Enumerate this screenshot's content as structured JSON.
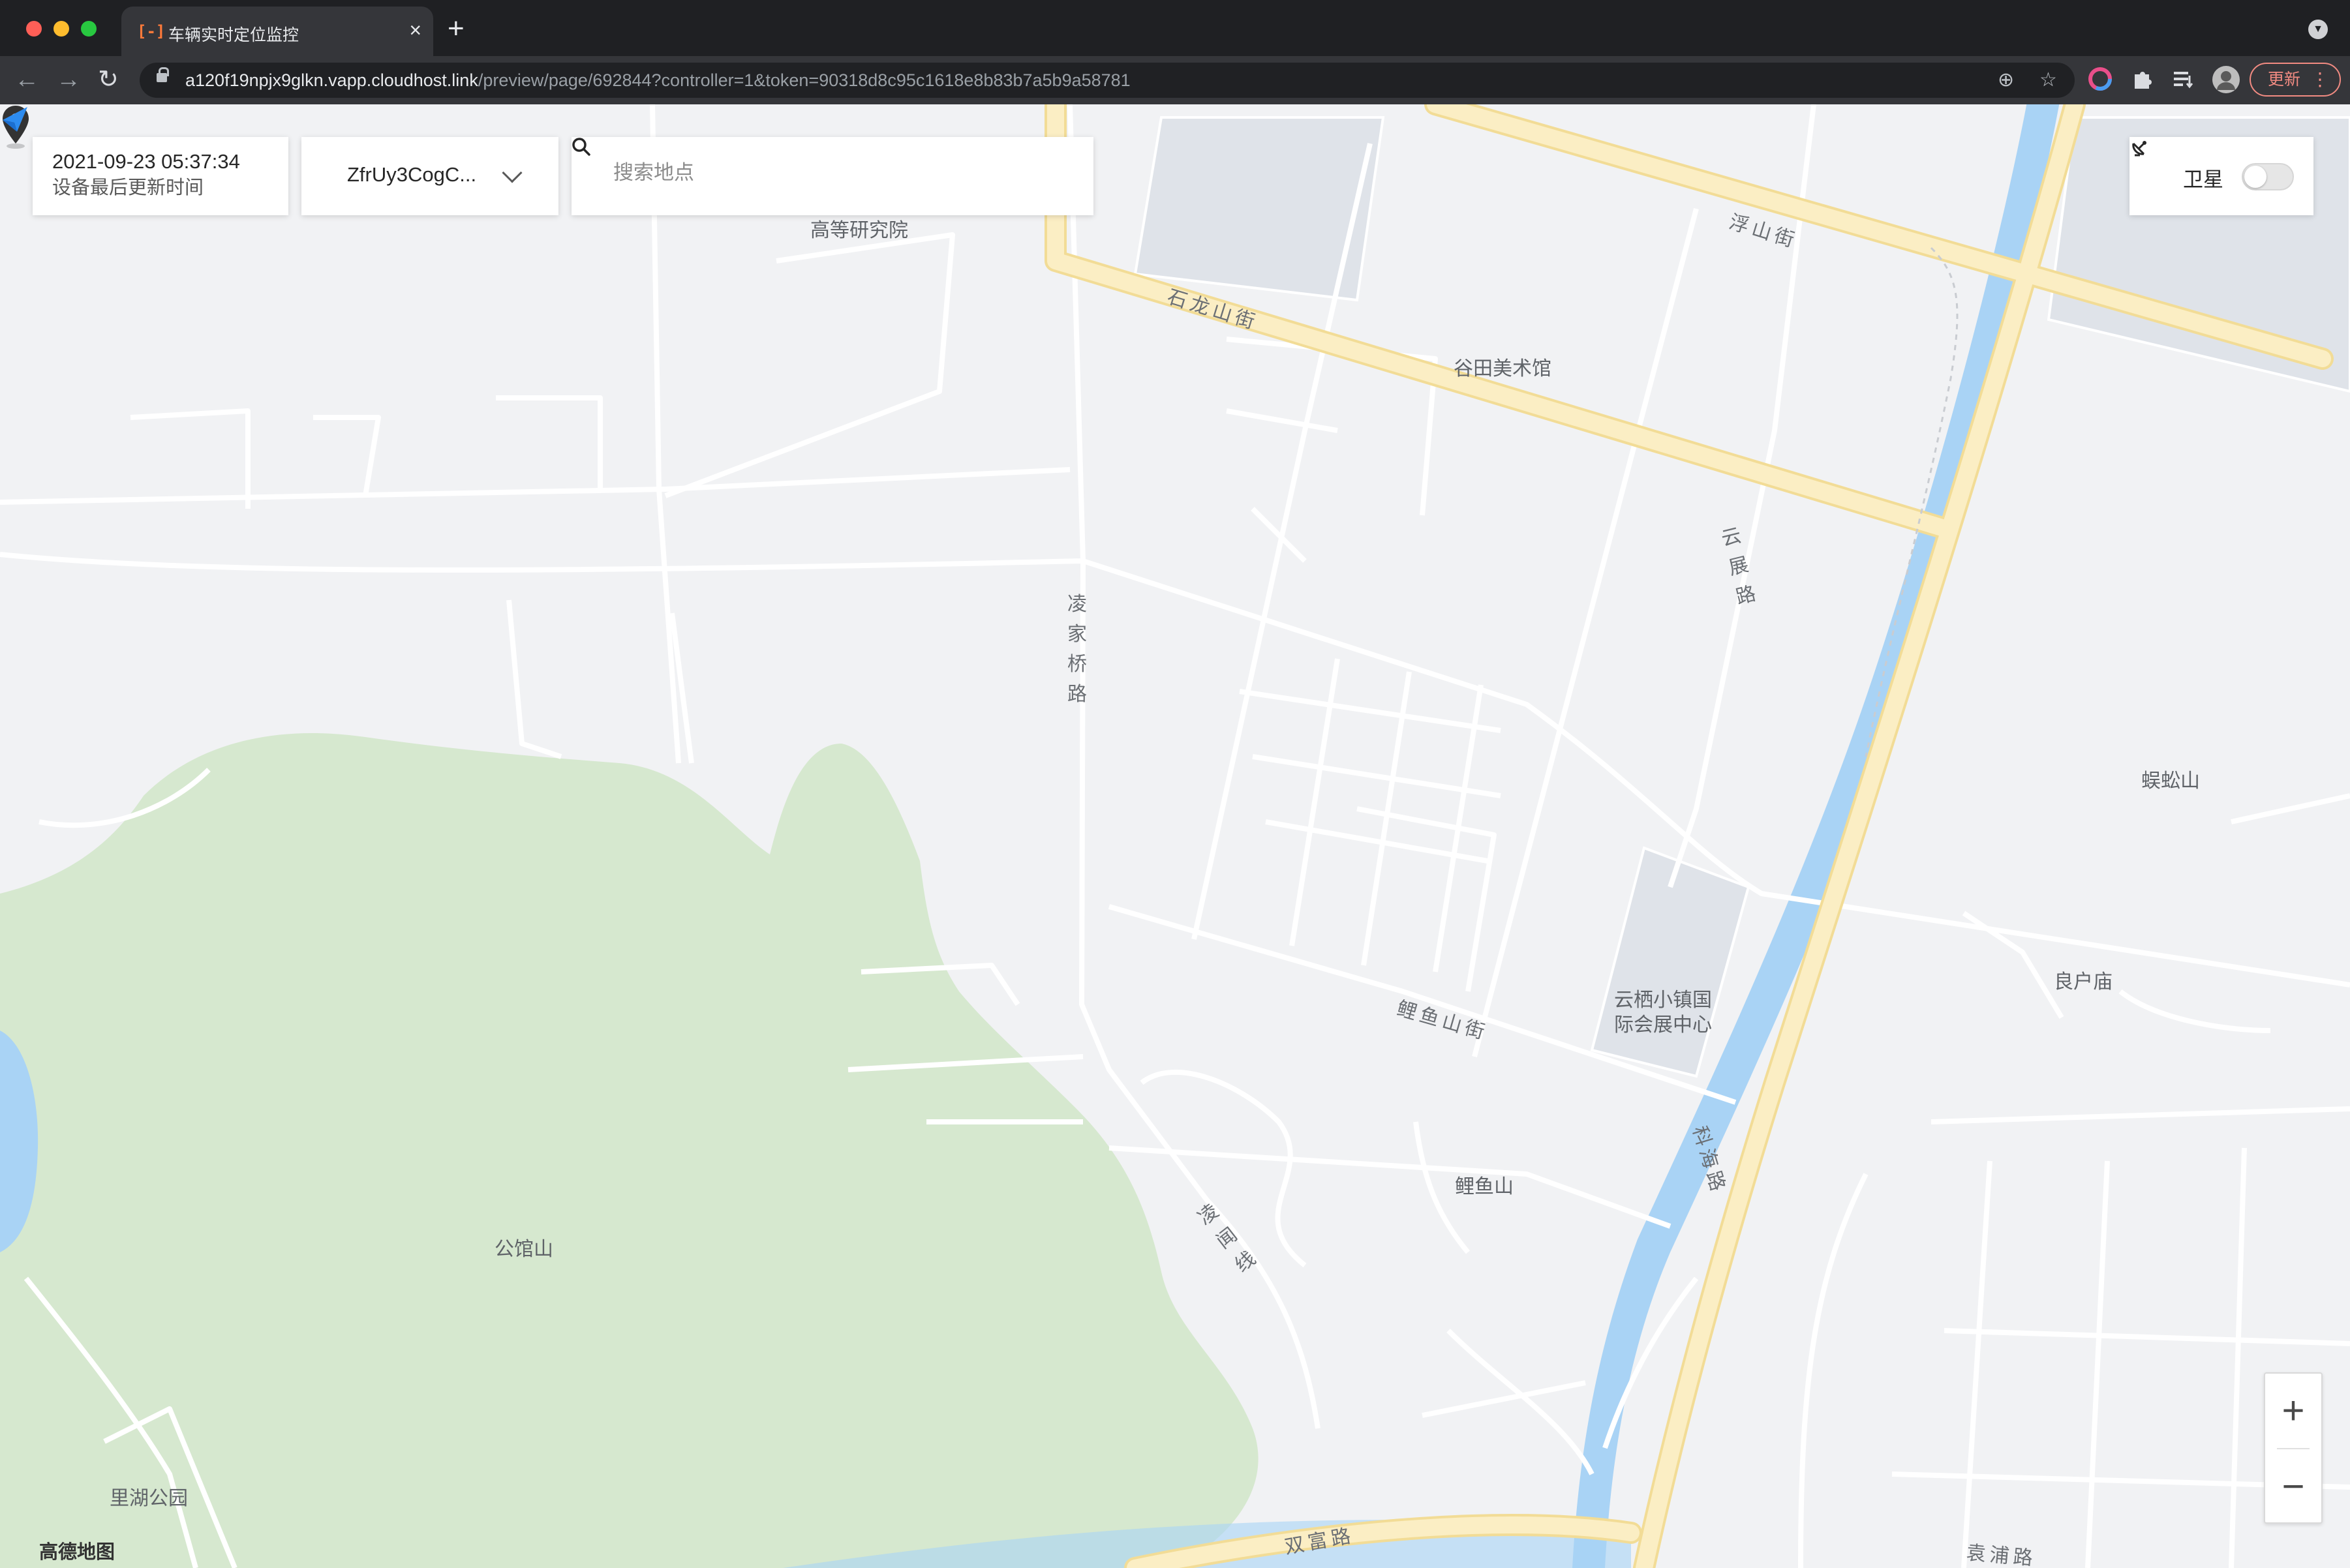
{
  "browser": {
    "window_controls": {
      "close_color": "#ff5f57",
      "minimize_color": "#febc2e",
      "maximize_color": "#28c840"
    },
    "tab": {
      "title": "车辆实时定位监控",
      "favicon": "[-]",
      "favicon_color": "#ff7a3a",
      "close_icon": "×"
    },
    "new_tab_icon": "+",
    "nav": {
      "back_icon": "←",
      "forward_icon": "→",
      "reload_icon": "↻"
    },
    "url": {
      "host": "a120f19npjx9glkn.vapp.cloudhost.link",
      "path": "/preview/page/692844?controller=1&token=90318d8c95c1618e8b83b7a5b9a58781"
    },
    "omnibox_icons": {
      "zoom_icon": "⊕",
      "bookmark_icon": "☆"
    },
    "update_button": {
      "label": "更新",
      "menu_icon": "⋮"
    }
  },
  "app": {
    "device_time": {
      "value": "2021-09-23 05:37:34",
      "label": "设备最后更新时间"
    },
    "device_select": {
      "selected": "ZfrUy3CogC..."
    },
    "search": {
      "placeholder": "搜索地点",
      "value": ""
    },
    "satellite": {
      "label": "卫星",
      "enabled": false
    },
    "zoom": {
      "in_label": "+",
      "out_label": "−"
    },
    "map_logo": {
      "text": "高德地图"
    }
  },
  "map": {
    "colors": {
      "background": "#f1f2f4",
      "park": "#d6e8cf",
      "water": "#a9d3f5",
      "major_road": "#fbeec4",
      "minor_road": "#ffffff",
      "block": "#dfe3e9"
    },
    "place_labels": [
      "高等研究院",
      "谷田美术馆",
      "蜈蚣山",
      "良户庙",
      "云栖小镇国",
      "际会展中心",
      "鲤鱼山",
      "公馆山",
      "里湖公园"
    ],
    "road_labels": {
      "fushan": "浮山街",
      "shilongshan": "石龙山街",
      "liyushan": "鲤鱼山街",
      "kehai": "科海路",
      "shuangfu": "双富路",
      "yuanpu": "袁浦路",
      "lingjiaqiao": [
        "凌",
        "家",
        "桥",
        "路"
      ],
      "yunzhan": [
        "云",
        "展",
        "路"
      ],
      "lingyin": [
        "凌",
        "闻",
        "线"
      ]
    },
    "marker": {
      "name": "vehicle-location",
      "color": "#333333"
    }
  }
}
